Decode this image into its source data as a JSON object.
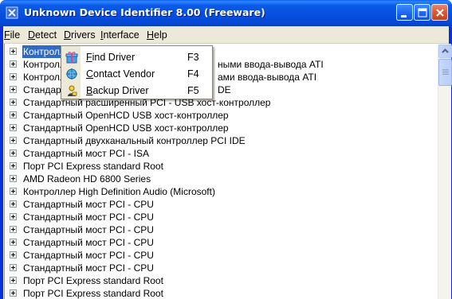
{
  "window": {
    "title": "Unknown Device Identifier 8.00 (Freeware)",
    "app_icon": "app-logo-icon",
    "controls": [
      "minimize-icon",
      "maximize-icon",
      "close-icon"
    ]
  },
  "menubar": {
    "items": [
      {
        "label_key": "F",
        "label_rest": "ile"
      },
      {
        "label_key": "D",
        "label_rest": "etect"
      },
      {
        "label_key": "D",
        "label_rest": "rivers"
      },
      {
        "label_key": "I",
        "label_rest": "nterface"
      },
      {
        "label_key": "H",
        "label_rest": "elp"
      }
    ]
  },
  "drivers_menu": {
    "items": [
      {
        "key": "F",
        "rest": "ind Driver",
        "shortcut": "F3",
        "icon": "gift-box-icon"
      },
      {
        "key": "C",
        "rest": "ontact Vendor",
        "shortcut": "F4",
        "icon": "network-icon"
      },
      {
        "key": "B",
        "rest": "ackup Driver",
        "shortcut": "F5",
        "icon": "person-icon"
      }
    ]
  },
  "device_list": {
    "selected_index": 0,
    "rows": [
      "Контролл",
      "Контролл",
      "Контролл",
      "Стандарт",
      "Стандартный расширенный PCI - USB хост-контроллер",
      "Стандартный OpenHCD USB хост-контроллер",
      "Стандартный OpenHCD USB хост-контроллер",
      "Стандартный двухканальный контроллер PCI IDE",
      "Стандартный мост PCI - ISA",
      "Порт PCI Express standard Root",
      "AMD Radeon HD 6800 Series",
      "Контроллер High Definition Audio (Microsoft)",
      "Стандартный мост PCI  - CPU",
      "Стандартный мост PCI  - CPU",
      "Стандартный мост PCI  - CPU",
      "Стандартный мост PCI  - CPU",
      "Стандартный мост PCI  - CPU",
      "Стандартный мост PCI  - CPU",
      "Порт PCI Express standard Root",
      "Порт PCI Express standard Root"
    ],
    "hidden_row_tails": [
      {
        "row": 1,
        "text": "ными ввода-вывода ATI"
      },
      {
        "row": 2,
        "text": "ами ввода-вывода ATI"
      },
      {
        "row": 3,
        "text": "DE"
      }
    ]
  },
  "colors": {
    "titlebar": "#0550e0",
    "selection": "#316ac5",
    "menu_bg": "#ece9d8"
  }
}
